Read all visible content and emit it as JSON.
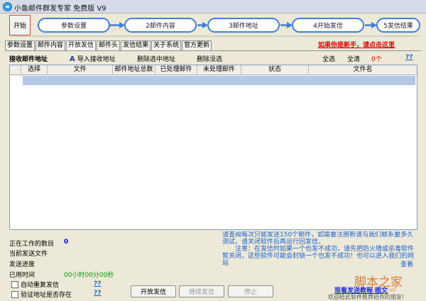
{
  "window": {
    "title": "小鱼邮件群发专家 免费版 V9"
  },
  "wizard": {
    "start_label": "开始",
    "steps": [
      "参数设置",
      "2邮件内容",
      "3邮件地址",
      "4开始发信",
      "5发信结果"
    ]
  },
  "tabs": [
    "参数设置",
    "邮件内容",
    "开放发信",
    "邮件头",
    "发信结果",
    "关于系统",
    "官方更新"
  ],
  "newbie_link": "如果你是新手，请点击这里",
  "toolbar": {
    "recipient_label": "接收邮件地址",
    "import_label": "导入接收地址",
    "delete_selected": "删除选中地址",
    "delete_unselected": "删除没选",
    "select_all": "全选",
    "clear_all": "全清",
    "count": "0个",
    "help": "??"
  },
  "table": {
    "columns": [
      "选择",
      "文件",
      "邮件地址总数",
      "已处理邮件",
      "未处理邮件",
      "状态",
      "文件名"
    ]
  },
  "status": {
    "working_label": "正在工作的数目",
    "working_value": "0",
    "current_file_label": "当前发送文件",
    "progress_label": "发送进度",
    "elapsed_label": "已用时间",
    "elapsed_value": "00小时00分00秒"
  },
  "options": {
    "auto_resend": "自动重复发信",
    "verify_address": "验证地址是否存在",
    "help": "??"
  },
  "buttons": {
    "start": "开放发信",
    "continue": "继续发信",
    "stop": "停止"
  },
  "notice": {
    "line1": "请查阅每次只能发送150个邮件，如需要注册新请与我们联系要多久测试，请关闭软件后再运行回发信。",
    "line2": "注意：在发信时如果一个也发不成功，请先把防火墙或杀毒软件暂关闭，这些软件可能会封锁一个也发不成功！也可以进入我们的网站",
    "look_here": "查看"
  },
  "help_link": "观看发送教程 图文",
  "bottom_note": "欢迎给此软件推荐给你的朋友!",
  "watermark": {
    "main": "脚本之家",
    "url": "www.jb51.net"
  }
}
